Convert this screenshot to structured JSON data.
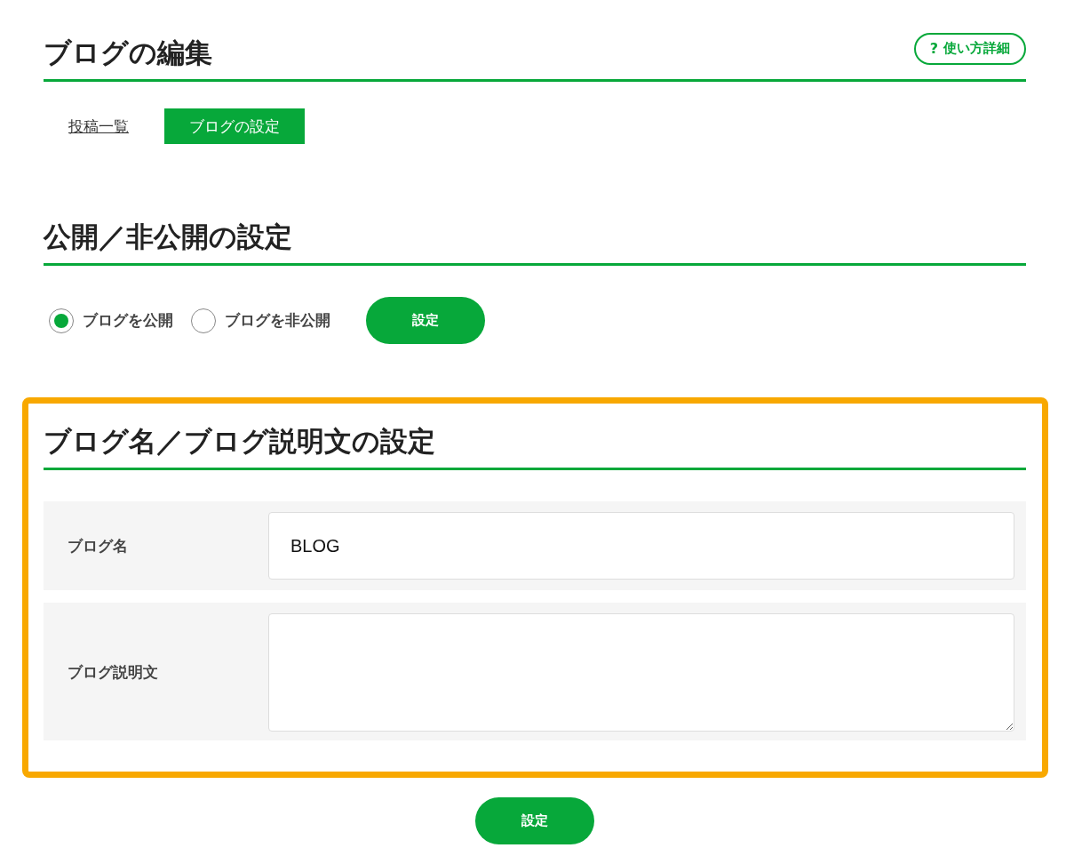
{
  "header": {
    "title": "ブログの編集",
    "help_button": {
      "icon": "?",
      "label": "使い方詳細"
    }
  },
  "tabs": [
    {
      "label": "投稿一覧",
      "selected": false
    },
    {
      "label": "ブログの設定",
      "selected": true
    }
  ],
  "visibility_section": {
    "heading": "公開／非公開の設定",
    "options": [
      {
        "label": "ブログを公開",
        "selected": true
      },
      {
        "label": "ブログを非公開",
        "selected": false
      }
    ],
    "submit_button": "設定"
  },
  "name_section": {
    "heading": "ブログ名／ブログ説明文の設定",
    "fields": [
      {
        "kind": "input",
        "label": "ブログ名",
        "value": "BLOG"
      },
      {
        "kind": "textarea",
        "label": "ブログ説明文"
      }
    ],
    "submit_button": "設定"
  }
}
